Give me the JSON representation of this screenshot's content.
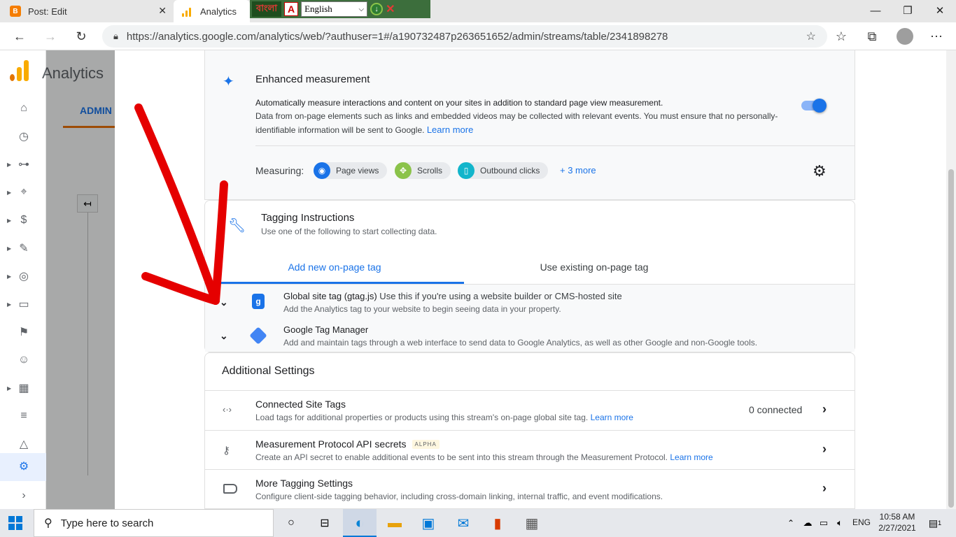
{
  "browser": {
    "tabs": [
      {
        "title": "Post: Edit",
        "icon": "blogger-icon"
      },
      {
        "title": "Analytics",
        "icon": "google-analytics-icon"
      }
    ],
    "extension": {
      "bangla_label": "বাংলা",
      "language_value": "English",
      "language_caret": "⌵"
    },
    "url": "https://analytics.google.com/analytics/web/?authuser=1#/a190732487p263651652/admin/streams/table/2341898278"
  },
  "ga": {
    "app_title": "Analytics",
    "admin_tab": "ADMIN",
    "accent_colors": {
      "primary": "#1a73e8",
      "orange": "#e8710a",
      "logo": [
        "#e37400",
        "#f9ab00"
      ]
    }
  },
  "enhanced": {
    "title": "Enhanced measurement",
    "lead": "Automatically measure interactions and content on your sites in addition to standard page view measurement.",
    "body": "Data from on-page elements such as links and embedded videos may be collected with relevant events. You must ensure that no personally-identifiable information will be sent to Google.",
    "learn_more": "Learn more",
    "toggle_on": true,
    "measuring_label": "Measuring:",
    "chips": [
      {
        "label": "Page views",
        "icon": "eye-icon",
        "color": "#1a73e8"
      },
      {
        "label": "Scrolls",
        "icon": "crosshair-icon",
        "color": "#8bc34a"
      },
      {
        "label": "Outbound clicks",
        "icon": "mouse-icon",
        "color": "#12b5cb"
      }
    ],
    "more": "+ 3 more"
  },
  "tagging": {
    "title": "Tagging Instructions",
    "subtitle": "Use one of the following to start collecting data.",
    "tabs": [
      "Add new on-page tag",
      "Use existing on-page tag"
    ],
    "active_tab": 0,
    "options": [
      {
        "title": "Global site tag (gtag.js)",
        "title_suffix": " Use this if you're using a website builder or CMS-hosted site",
        "desc": "Add the Analytics tag to your website to begin seeing data in your property."
      },
      {
        "title": "Google Tag Manager",
        "title_suffix": "",
        "desc": "Add and maintain tags through a web interface to send data to Google Analytics, as well as other Google and non-Google tools."
      }
    ]
  },
  "additional": {
    "title": "Additional Settings",
    "rows": [
      {
        "title": "Connected Site Tags",
        "desc": "Load tags for additional properties or products using this stream's on-page global site tag.",
        "link": "Learn more",
        "meta": "0 connected"
      },
      {
        "title": "Measurement Protocol API secrets",
        "badge": "ALPHA",
        "desc": "Create an API secret to enable additional events to be sent into this stream through the Measurement Protocol.",
        "link": "Learn more",
        "meta": ""
      },
      {
        "title": "More Tagging Settings",
        "desc": "Configure client-side tagging behavior, including cross-domain linking, internal traffic, and event modifications.",
        "link": "",
        "meta": ""
      }
    ]
  },
  "taskbar": {
    "search_placeholder": "Type here to search",
    "lang": "ENG",
    "time": "10:58 AM",
    "date": "2/27/2021",
    "notifications": "1"
  }
}
